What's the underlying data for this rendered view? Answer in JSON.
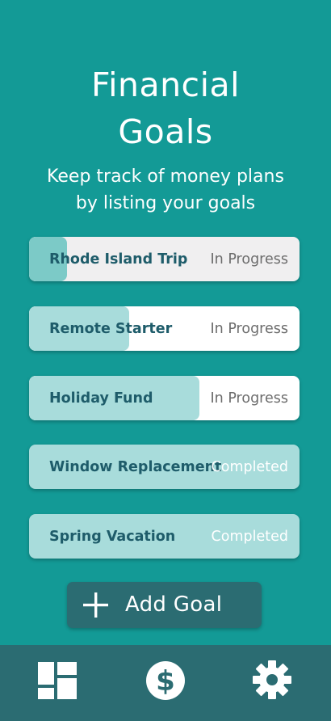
{
  "header": {
    "title_line1": "Financial",
    "title_line2": "Goals",
    "subtitle_line1": "Keep track of money plans",
    "subtitle_line2": "by listing your goals"
  },
  "goals": [
    {
      "name": "Rhode Island Trip",
      "status": "In Progress",
      "progress": 0.14
    },
    {
      "name": "Remote Starter",
      "status": "In Progress",
      "progress": 0.37
    },
    {
      "name": "Holiday Fund",
      "status": "In Progress",
      "progress": 0.63
    },
    {
      "name": "Window Replacement",
      "status": "Completed",
      "progress": 1.0
    },
    {
      "name": "Spring Vacation",
      "status": "Completed",
      "progress": 1.0
    }
  ],
  "add_button": {
    "label": "Add Goal",
    "icon": "plus-icon"
  },
  "bottom_nav": {
    "items": [
      {
        "icon": "dashboard-icon"
      },
      {
        "icon": "dollar-icon"
      },
      {
        "icon": "gear-icon"
      }
    ]
  },
  "colors": {
    "background": "#139a96",
    "card": "#ffffff",
    "progress_fill": "#a8dcdb",
    "dark_panel": "#2b6c72",
    "goal_text": "#1e5c6a"
  }
}
